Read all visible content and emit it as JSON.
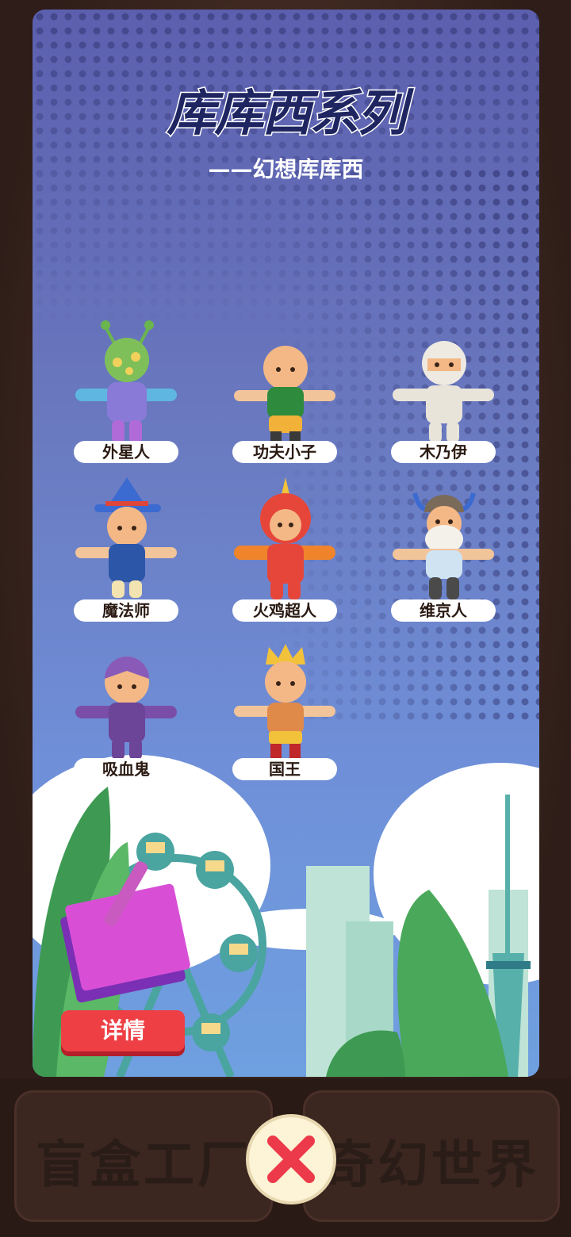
{
  "background": {
    "buttons": [
      {
        "label": "盲盒工厂"
      },
      {
        "label": "奇幻世界"
      }
    ]
  },
  "panel": {
    "title": "库库西系列",
    "subtitle": "——幻想库库西",
    "characters": [
      {
        "name": "外星人",
        "icon": "alien-figure"
      },
      {
        "name": "功夫小子",
        "icon": "kungfu-kid-figure"
      },
      {
        "name": "木乃伊",
        "icon": "mummy-figure"
      },
      {
        "name": "魔法师",
        "icon": "wizard-figure"
      },
      {
        "name": "火鸡超人",
        "icon": "turkey-hero-figure"
      },
      {
        "name": "维京人",
        "icon": "viking-figure"
      },
      {
        "name": "吸血鬼",
        "icon": "vampire-figure"
      },
      {
        "name": "国王",
        "icon": "king-figure"
      }
    ],
    "detail_button": "详情"
  },
  "close_button": {
    "icon": "close-x-icon"
  },
  "colors": {
    "accent_red": "#ee3f44",
    "title_navy": "#1e2560",
    "panel_blue": "#6a7ac0"
  }
}
